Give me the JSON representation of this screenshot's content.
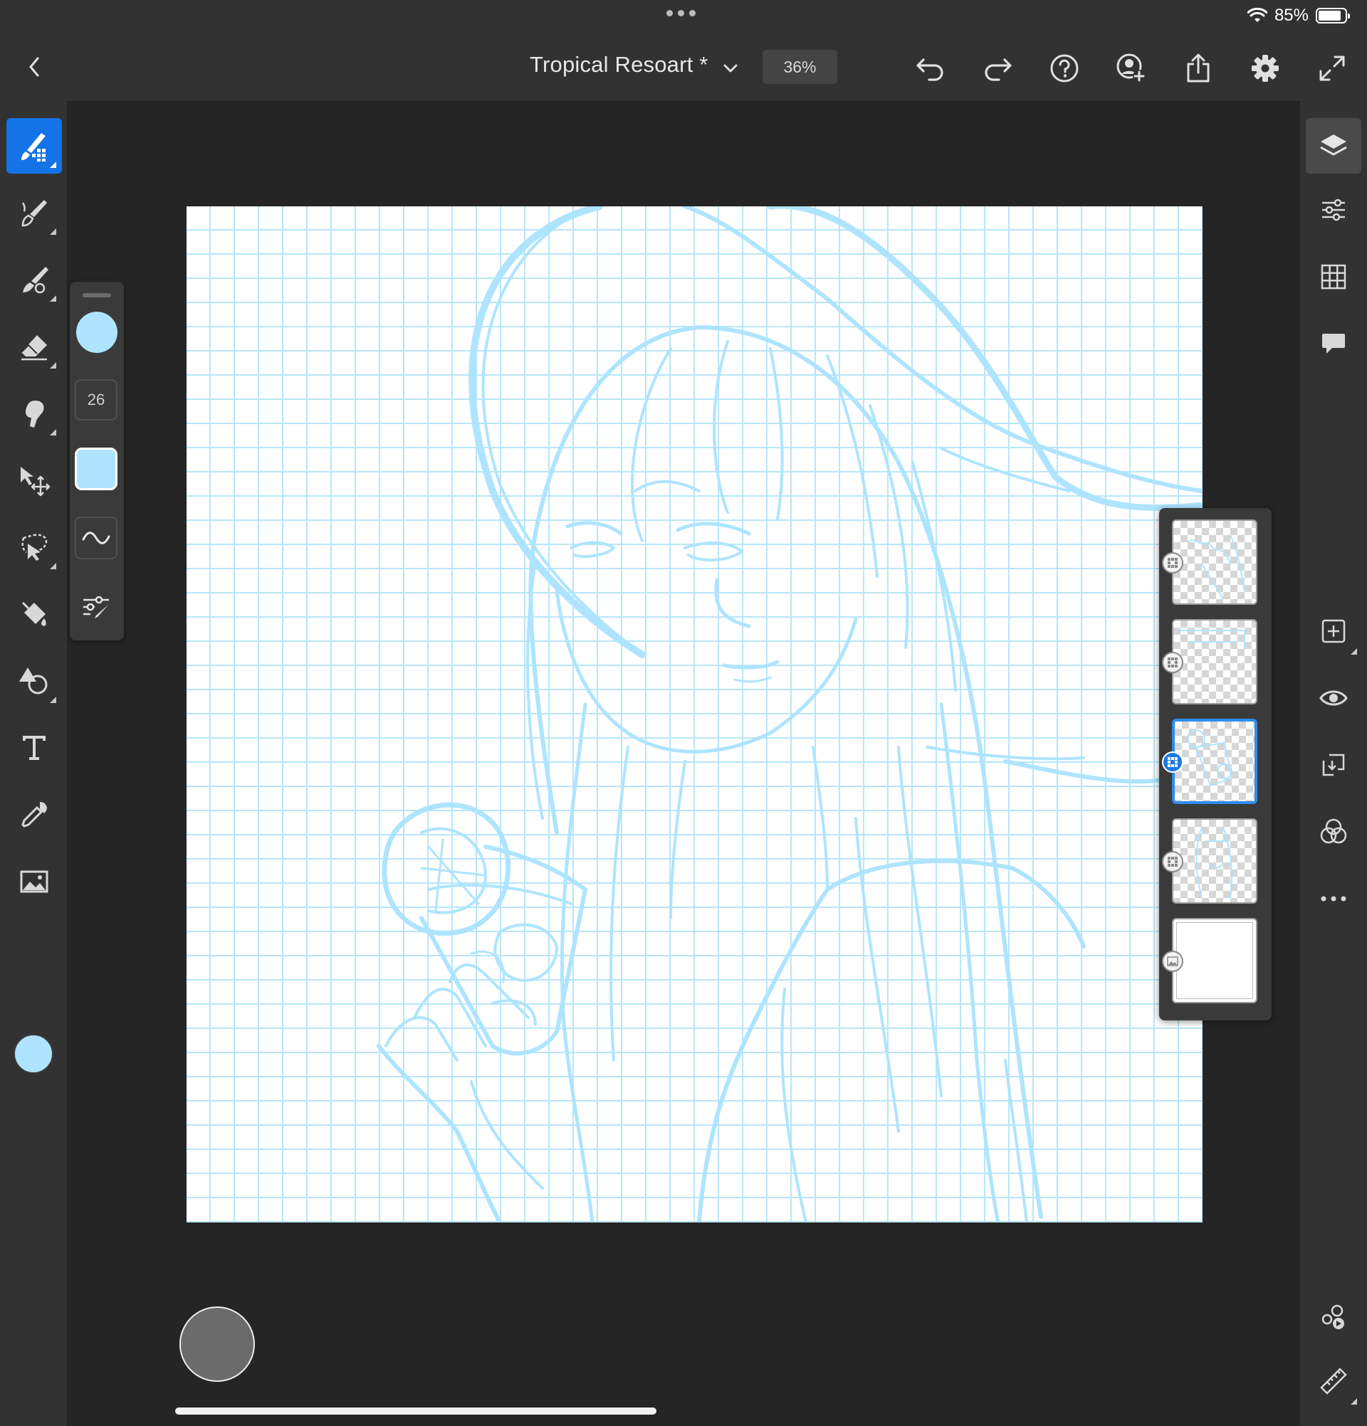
{
  "status_bar": {
    "battery_percent": "85%",
    "battery_level": 0.85
  },
  "header": {
    "document_title": "Tropical Resoart *",
    "zoom_level": "36%"
  },
  "brush_panel": {
    "brush_size": "26",
    "color_hex": "#aee4ff"
  },
  "colors": {
    "accent": "#1473e6",
    "selected_layer_border": "#2d8ceb",
    "stroke_color": "#aee4ff",
    "grid_color": "#b8e6f8"
  },
  "left_tools": [
    {
      "name": "pixel-brush-tool",
      "icon": "pixel-brush-icon",
      "active": true
    },
    {
      "name": "live-brush-tool",
      "icon": "live-brush-icon",
      "active": false
    },
    {
      "name": "vector-brush-tool",
      "icon": "vector-brush-icon",
      "active": false
    },
    {
      "name": "eraser-tool",
      "icon": "eraser-icon",
      "active": false
    },
    {
      "name": "smudge-tool",
      "icon": "smudge-icon",
      "active": false
    },
    {
      "name": "transform-tool",
      "icon": "move-icon",
      "active": false
    },
    {
      "name": "selection-tool",
      "icon": "lasso-icon",
      "active": false
    },
    {
      "name": "fill-tool",
      "icon": "paint-bucket-icon",
      "active": false
    },
    {
      "name": "shapes-tool",
      "icon": "shapes-icon",
      "active": false
    },
    {
      "name": "text-tool",
      "icon": "text-icon",
      "active": false
    },
    {
      "name": "eyedropper-tool",
      "icon": "eyedropper-icon",
      "active": false
    },
    {
      "name": "place-image-tool",
      "icon": "image-icon",
      "active": false
    }
  ],
  "layers": [
    {
      "name": "layer-1",
      "type": "pixel",
      "selected": false
    },
    {
      "name": "layer-2",
      "type": "pixel",
      "selected": false
    },
    {
      "name": "layer-3",
      "type": "pixel",
      "selected": true
    },
    {
      "name": "layer-4",
      "type": "pixel",
      "selected": false
    },
    {
      "name": "background-layer",
      "type": "image",
      "selected": false
    }
  ]
}
